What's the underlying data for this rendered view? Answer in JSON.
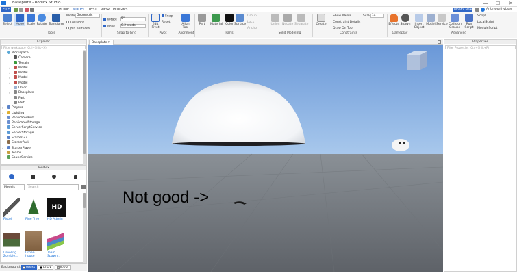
{
  "window": {
    "title": "Baseplate - Roblox Studio",
    "minimize": "—",
    "maximize": "☐",
    "close": "✕"
  },
  "menu": {
    "file": "FILE",
    "items": [
      "HOME",
      "MODEL",
      "TEST",
      "VIEW",
      "PLUGINS"
    ],
    "active": "MODEL",
    "help": "What's New",
    "user": "AnUnworthyUser"
  },
  "ribbon": {
    "tools": {
      "select": "Select",
      "move": "Move",
      "scale": "Scale",
      "rotate": "Rotate",
      "transform": "Transform",
      "group": "Tools"
    },
    "mode_label": "Mode:",
    "mode_value": "Geometric",
    "collisions": "Collisions",
    "join_surfaces": "Join Surfaces",
    "rotate": "Rotate",
    "rotate_value": "5°",
    "move": "Move",
    "move_value": "0.2 studs",
    "snap_group": "Snap to Grid",
    "edit_pivot": "Edit Pivot",
    "snap": "Snap",
    "reset": "Reset",
    "pivot_group": "Pivot",
    "align_tool": "Align Tool",
    "alignment_group": "Alignment",
    "part": "Part",
    "material": "Material",
    "color": "Color",
    "surface": "Surface",
    "group_btn": "Group",
    "lock": "Lock",
    "anchor": "Anchor",
    "parts_group": "Parts",
    "union": "Union",
    "negate": "Negate",
    "separate": "Separate",
    "solid_group": "Solid Modeling",
    "create": "Create",
    "show_welds": "Show Welds",
    "constraint_details": "Constraint Details",
    "draw_on_top": "Draw On Top",
    "scale_label": "Scale",
    "scale_value": "1x",
    "constraints_group": "Constraints",
    "effects": "Effects",
    "spawn": "Spawn",
    "gameplay_group": "Gameplay",
    "insert_object": "Insert Object",
    "model": "Model",
    "service": "Service",
    "collision_groups": "Collision Groups",
    "run_script": "Run Script",
    "script": "Script",
    "local_script": "LocalScript",
    "module_script": "ModuleScript",
    "advanced_group": "Advanced"
  },
  "explorer": {
    "title": "Explorer",
    "filter": "Filter workspace (Ctrl+Shift+X)",
    "items": [
      "Workspace",
      "Camera",
      "Terrain",
      "Model",
      "Model",
      "Model",
      "Model",
      "Union",
      "Baseplate",
      "Part",
      "Part",
      "Players",
      "Lighting",
      "ReplicatedFirst",
      "ReplicatedStorage",
      "ServerScriptService",
      "ServerStorage",
      "StarterGui",
      "StarterPack",
      "StarterPlayer",
      "Teams",
      "SoundService"
    ]
  },
  "toolbox": {
    "title": "Toolbox",
    "category": "Models",
    "search_placeholder": "Search",
    "assets": [
      "Pistol",
      "Pine Tree",
      "HD Admin",
      "Drooling Zombie...",
      "Urban house",
      "Team Spawn..."
    ],
    "background_label": "Background:",
    "bg_white": "White",
    "bg_black": "Black",
    "bg_none": "None"
  },
  "viewport": {
    "tab": "Baseplate",
    "annotation": "Not good ->"
  },
  "properties": {
    "title": "Properties",
    "filter": "Filter Properties (Ctrl+Shift+P)"
  }
}
